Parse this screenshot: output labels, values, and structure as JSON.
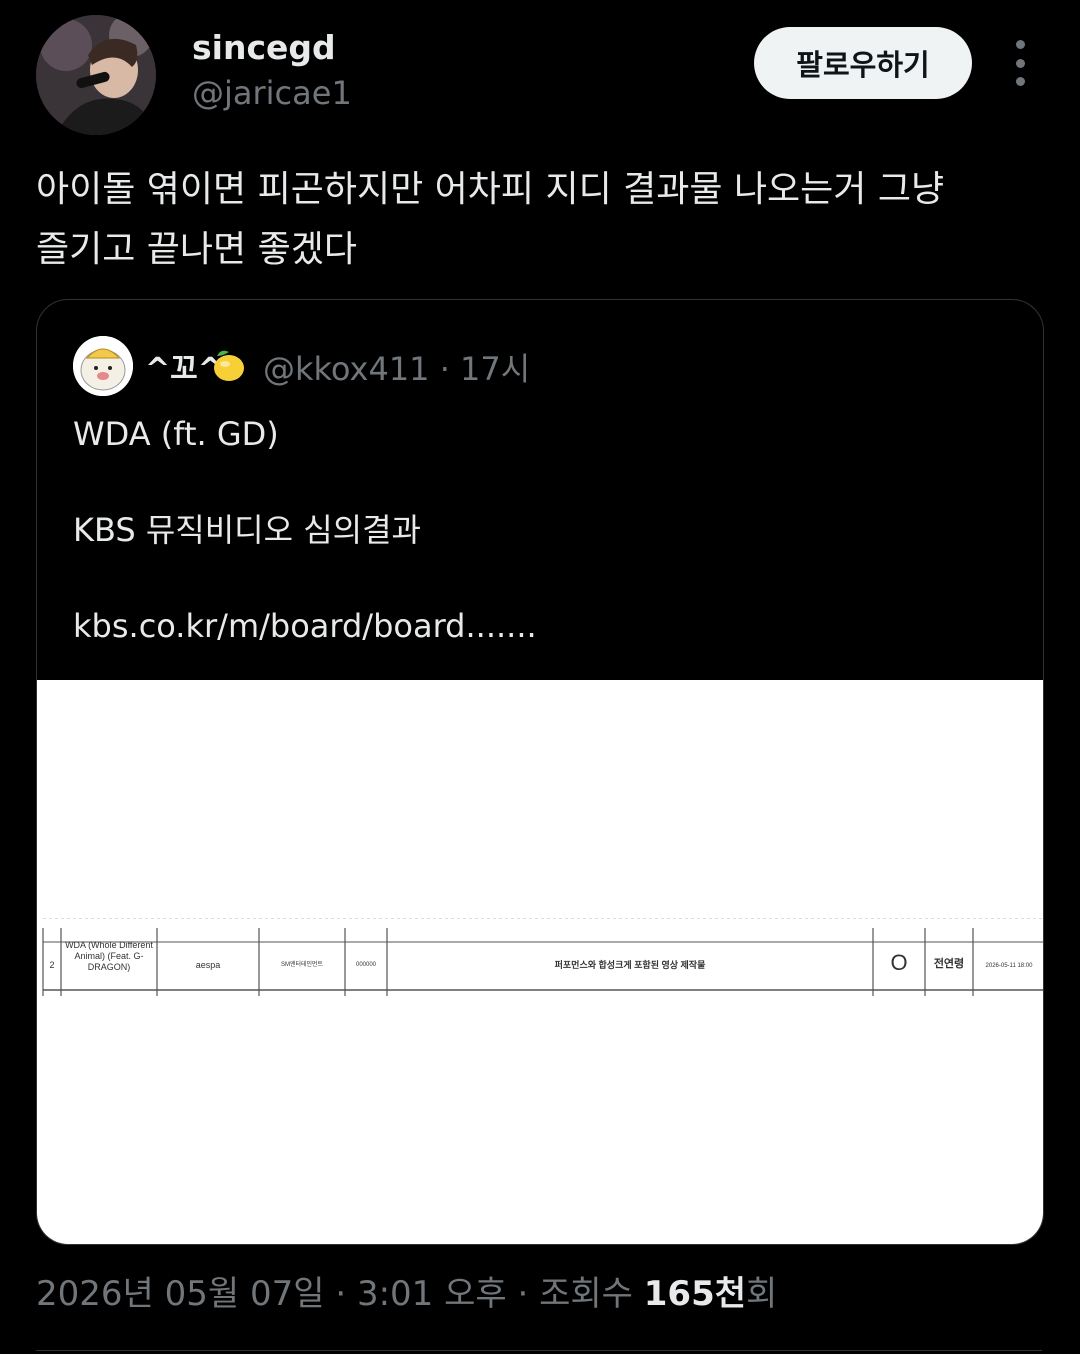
{
  "author": {
    "display_name": "sincegd",
    "handle": "@jaricae1",
    "avatar_icon": "profile-photo"
  },
  "follow_button": {
    "label": "팔로우하기"
  },
  "more_icon": "more-vertical-icon",
  "tweet": {
    "text": "아이돌 엮이면 피곤하지만 어차피 지디 결과물 나오는거 그냥\n즐기고 끝나면 좋겠다"
  },
  "quote": {
    "display_name": "^꼬^",
    "name_emoji": "lemon-icon",
    "handle": "@kkox411",
    "time_sep": " · ",
    "time": "17시",
    "text": "WDA (ft. GD)\n\nKBS 뮤직비디오 심의결과\n\nkbs.co.kr/m/board/board.......",
    "image": {
      "row_number": "2",
      "title": "WDA (Whole Different Animal) (Feat. G-DRAGON)",
      "artist": "aespa",
      "agency": "SM엔터테인먼트",
      "code": "000000",
      "note": "퍼포먼스와 합성크게 포함된 영상 제작물",
      "result": "O",
      "reviewer": "전연령",
      "date": "2026-05-11 18:00"
    }
  },
  "meta": {
    "date": "2026년 05월 07일",
    "sep1": " · ",
    "time": "3:01 오후",
    "sep2": " · ",
    "views_label": "조회수 ",
    "views_count": "165천",
    "views_suffix": "회"
  }
}
